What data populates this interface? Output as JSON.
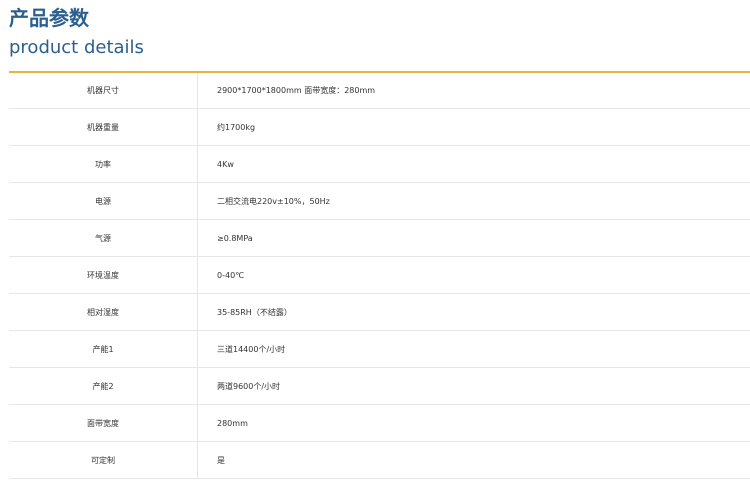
{
  "header": {
    "title_zh": "产品参数",
    "title_en": "product details"
  },
  "colors": {
    "title": "#2b5f8e",
    "accent_rule": "#e5b53c",
    "border": "#e6e6e6",
    "text": "#333333"
  },
  "specs": [
    {
      "label": "机器尺寸",
      "value": "2900*1700*1800mm 面带宽度：280mm"
    },
    {
      "label": "机器重量",
      "value": "约1700kg"
    },
    {
      "label": "功率",
      "value": "4Kw"
    },
    {
      "label": "电源",
      "value": "二相交流电220v±10%，50Hz"
    },
    {
      "label": "气源",
      "value": "≥0.8MPa"
    },
    {
      "label": "环境温度",
      "value": "0-40℃"
    },
    {
      "label": "相对湿度",
      "value": "35-85RH（不结露）"
    },
    {
      "label": "产能1",
      "value": "三道14400个/小时"
    },
    {
      "label": "产能2",
      "value": "两道9600个/小时"
    },
    {
      "label": "面带宽度",
      "value": "280mm"
    },
    {
      "label": "可定制",
      "value": "是"
    }
  ]
}
